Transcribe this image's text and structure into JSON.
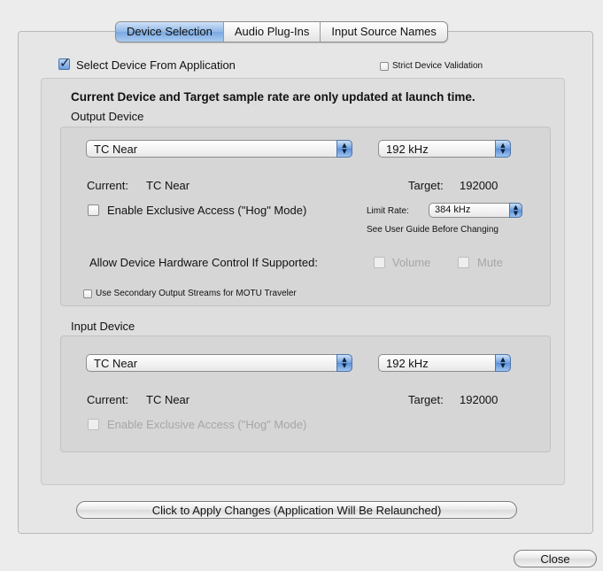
{
  "tabs": [
    {
      "label": "Device Selection",
      "active": true
    },
    {
      "label": "Audio Plug-Ins",
      "active": false
    },
    {
      "label": "Input Source Names",
      "active": false
    }
  ],
  "select_device": {
    "label": "Select Device From Application",
    "checked": true
  },
  "strict_validation": {
    "label": "Strict Device Validation",
    "checked": false
  },
  "notice": "Current Device and Target sample rate are only updated at launch time.",
  "output": {
    "group_label": "Output Device",
    "device": "TC Near",
    "rate": "192 kHz",
    "current_label": "Current:",
    "current_value": "TC Near",
    "target_label": "Target:",
    "target_value": "192000",
    "hog_label": "Enable Exclusive Access (\"Hog\" Mode)",
    "limit_rate_label": "Limit Rate:",
    "limit_rate_value": "384 kHz",
    "guide_note": "See User Guide Before Changing",
    "hw_control_label": "Allow Device Hardware Control If Supported:",
    "volume_label": "Volume",
    "mute_label": "Mute",
    "secondary_label": "Use Secondary Output Streams for MOTU Traveler"
  },
  "input": {
    "group_label": "Input Device",
    "device": "TC Near",
    "rate": "192 kHz",
    "current_label": "Current:",
    "current_value": "TC Near",
    "target_label": "Target:",
    "target_value": "192000",
    "hog_label": "Enable Exclusive Access (\"Hog\" Mode)"
  },
  "apply_button": "Click to Apply Changes (Application Will Be Relaunched)",
  "close_button": "Close",
  "icons": {
    "popup_arrows": "up-down-arrows-icon",
    "checkmark": "checkmark-icon"
  }
}
